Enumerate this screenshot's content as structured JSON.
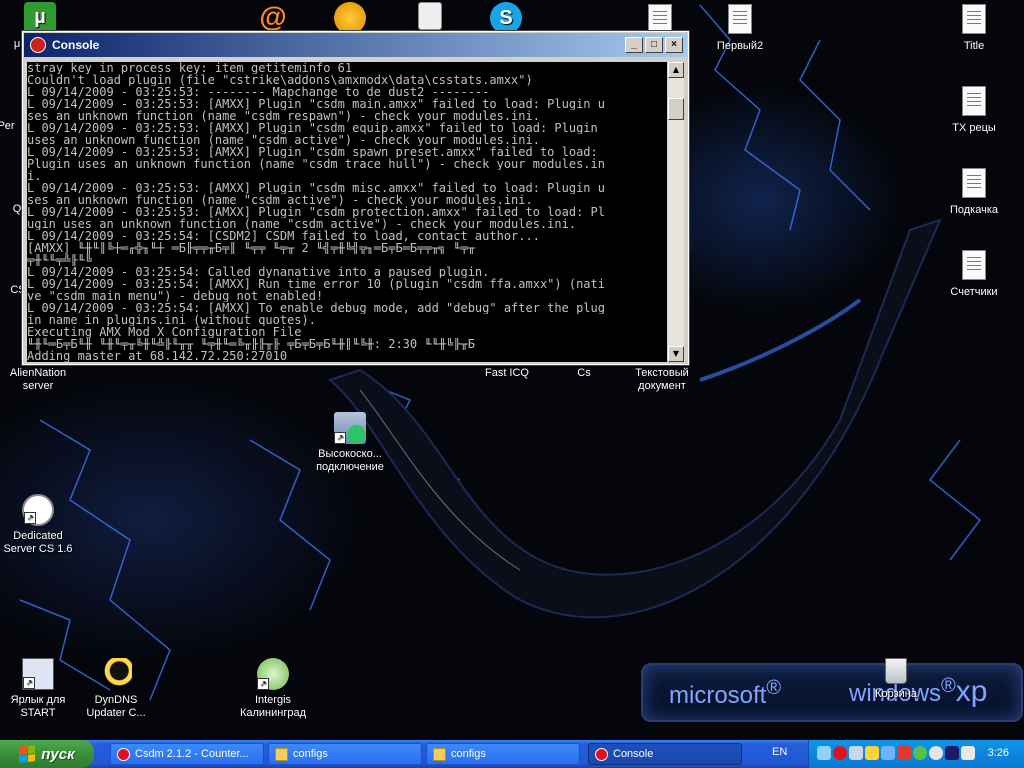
{
  "colors": {
    "title_bar_start": "#0a246a",
    "title_bar_end": "#a6caf0",
    "console_bg": "#000000",
    "console_text": "#c0c0c0",
    "taskbar": "#245edb",
    "start_button": "#3c8f3a",
    "tray": "#0b77d3",
    "wallpaper_accent": "#3f7dff"
  },
  "window": {
    "title": "Console",
    "icon": "halflife-lambda-icon",
    "minimize": "_",
    "maximize": "□",
    "close": "×",
    "lines": [
      "stray key in process_key: item_getiteminfo 61",
      "Couldn't load plugin (file \"cstrike\\addons\\amxmodx\\data\\csstats.amxx\")",
      "L 09/14/2009 - 03:25:53: -------- Mapchange to de_dust2 --------",
      "L 09/14/2009 - 03:25:53: [AMXX] Plugin \"csdm_main.amxx\" failed to load: Plugin u",
      "ses an unknown function (name \"csdm_respawn\") - check your modules.ini.",
      "L 09/14/2009 - 03:25:53: [AMXX] Plugin \"csdm_equip.amxx\" failed to load: Plugin",
      "uses an unknown function (name \"csdm_active\") - check your modules.ini.",
      "L 09/14/2009 - 03:25:53: [AMXX] Plugin \"csdm_spawn_preset.amxx\" failed to load:",
      "Plugin uses an unknown function (name \"csdm_trace_hull\") - check your modules.in",
      "i.",
      "L 09/14/2009 - 03:25:53: [AMXX] Plugin \"csdm_misc.amxx\" failed to load: Plugin u",
      "ses an unknown function (name \"csdm_active\") - check your modules.ini.",
      "L 09/14/2009 - 03:25:53: [AMXX] Plugin \"csdm_protection.amxx\" failed to load: Pl",
      "ugin uses an unknown function (name \"csdm_active\") - check your modules.ini.",
      "L 09/14/2009 - 03:25:54: [CSDM2] CSDM failed to load, contact author...",
      "[AMXX] ╙╫╙║╚┼═╓╬╖╙┼ ═Б╟╤╤╥Б╤║ ╙╤╤ ╙╤╥ 2 ╙╣╤╫╚╣╦╖═Б╤Б═Б╤╤╥╗ ╙╤╥",
      "╤╫╙╙╤╩╟╙╚",
      "L 09/14/2009 - 03:25:54: Called dynanative into a paused plugin.",
      "L 09/14/2009 - 03:25:54: [AMXX] Run time error 10 (plugin \"csdm_ffa.amxx\") (nati",
      "ve \"csdm_main_menu\") - debug not enabled!",
      "L 09/14/2009 - 03:25:54: [AMXX] To enable debug mode, add \"debug\" after the plug",
      "in name in plugins.ini (without quotes).",
      "Executing AMX Mod X Configuration File",
      "╙╫╙═Б╤Б╙╫ ╙╫╙╤╥╚╫╙╩╟╙╥╥ ╙╤╫╙═╚╥╟╟╥╟ ╤Б╤Б╤Б╙╫║╙╚╫: 2:30 ╙╙╫╚╟╥Б",
      "Adding master at 68.142.72.250:27010"
    ]
  },
  "desktop_icons": {
    "top_row_labels": [
      "Первый2",
      "Title"
    ],
    "right_column": [
      "TX рецы",
      "Подкачка",
      "Счетчики"
    ],
    "second_row": [
      "AlienNation server",
      "Fast ICQ",
      "Cs",
      "Текстовый документ"
    ],
    "center": "Высокоско... подключение",
    "left_middle": "Dedicated Server CS 1.6",
    "bottom_row": [
      "Ярлык для START",
      "DynDNS Updater C...",
      "Intergis Калининград"
    ],
    "recycle": "Корзина",
    "partial_left": [
      "Per",
      "Q",
      "CS",
      "μ"
    ]
  },
  "wallpaper": {
    "brand": "microsoft",
    "brand_mark": "®",
    "os": "windows",
    "os_mark": "®",
    "os_version": "xp"
  },
  "taskbar": {
    "start_label": "пуск",
    "buttons": [
      {
        "label": "Csdm 2.1.2 - Counter...",
        "icon": "opera-icon",
        "active": false
      },
      {
        "label": "configs",
        "icon": "folder-icon",
        "active": false
      },
      {
        "label": "configs",
        "icon": "folder-icon",
        "active": false
      },
      {
        "label": "Console",
        "icon": "halflife-lambda-icon",
        "active": true
      }
    ],
    "language": "EN",
    "clock": "3:26"
  }
}
